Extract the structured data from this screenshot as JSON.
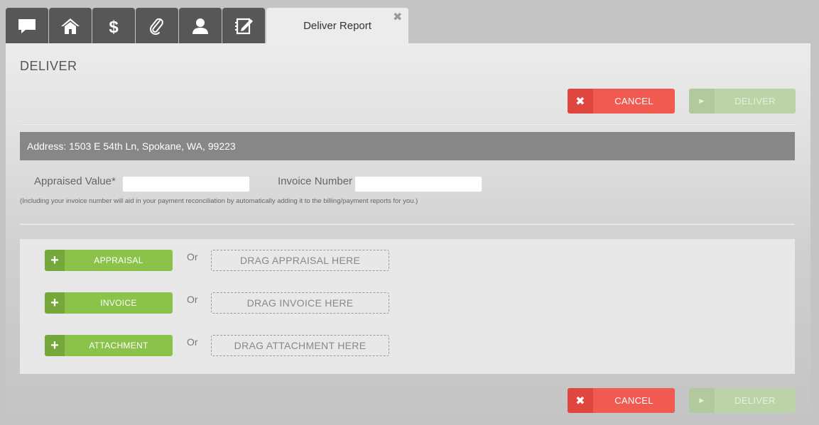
{
  "tabs": {
    "icons": [
      "chat-icon",
      "home-icon",
      "dollar-icon",
      "paperclip-icon",
      "user-icon",
      "note-icon"
    ],
    "active_label": "Deliver Report",
    "close_glyph": "✖"
  },
  "page": {
    "title": "DELIVER"
  },
  "actions": {
    "cancel_label": "CANCEL",
    "deliver_label": "DELIVER",
    "cancel_icon": "✖",
    "deliver_icon": "▶"
  },
  "address": {
    "text": "Address: 1503 E 54th Ln, Spokane, WA, 99223"
  },
  "form": {
    "appraised_value_label": "Appraised Value*",
    "appraised_value": "",
    "invoice_number_label": "Invoice Number",
    "invoice_number": "",
    "hint": "(Including your invoice number will aid in your payment reconciliation by automatically adding it to the billing/payment reports for you.)"
  },
  "uploads": [
    {
      "button_label": "APPRAISAL",
      "or_text": "Or",
      "drop_label": "DRAG APPRAISAL HERE"
    },
    {
      "button_label": "INVOICE",
      "or_text": "Or",
      "drop_label": "DRAG INVOICE HERE"
    },
    {
      "button_label": "ATTACHMENT",
      "or_text": "Or",
      "drop_label": "DRAG ATTACHMENT HERE"
    }
  ],
  "colors": {
    "cancel": "#f15a50",
    "deliver_disabled": "#bcd3a8",
    "upload_button": "#8bc34a",
    "address_bar": "#878787",
    "tab_bg": "#575757"
  }
}
